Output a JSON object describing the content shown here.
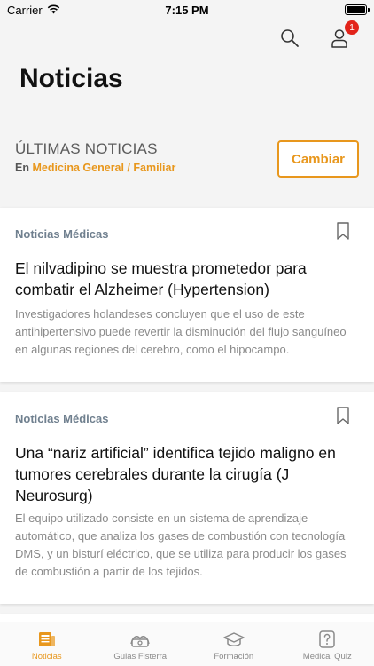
{
  "status_bar": {
    "carrier": "Carrier",
    "time": "7:15 PM"
  },
  "header": {
    "title": "Noticias",
    "notification_count": "1",
    "search_icon": "search-icon",
    "profile_icon": "user-icon"
  },
  "latest": {
    "title": "ÚLTIMAS NOTICIAS",
    "prefix": "En",
    "category": "Medicina General / Familiar",
    "change_label": "Cambiar"
  },
  "articles": [
    {
      "category": "Noticias Médicas",
      "title": "El nilvadipino se muestra prometedor para combatir el Alzheimer (Hypertension)",
      "description": "Investigadores holandeses concluyen que el uso de este antihipertensivo puede revertir la disminución del flujo sanguíneo en algunas regiones del cerebro, como el hipocampo."
    },
    {
      "category": "Noticias Médicas",
      "title": "Una “nariz artificial” identifica tejido maligno en tumores cerebrales durante la cirugía (J Neurosurg)",
      "description": "El equipo utilizado consiste en un sistema de aprendizaje automático, que analiza los gases de combustión con tecnología DMS, y un bisturí eléctrico, que se utiliza para producir los gases de combustión a partir de los tejidos."
    }
  ],
  "tabs": [
    {
      "label": "Noticias",
      "icon": "newspaper-icon",
      "active": true
    },
    {
      "label": "Guias Fisterra",
      "icon": "guides-icon",
      "active": false
    },
    {
      "label": "Formación",
      "icon": "graduation-cap-icon",
      "active": false
    },
    {
      "label": "Medical Quiz",
      "icon": "quiz-icon",
      "active": false
    }
  ],
  "colors": {
    "accent": "#e8971d",
    "badge": "#e2231a",
    "category_text": "#70808f"
  }
}
